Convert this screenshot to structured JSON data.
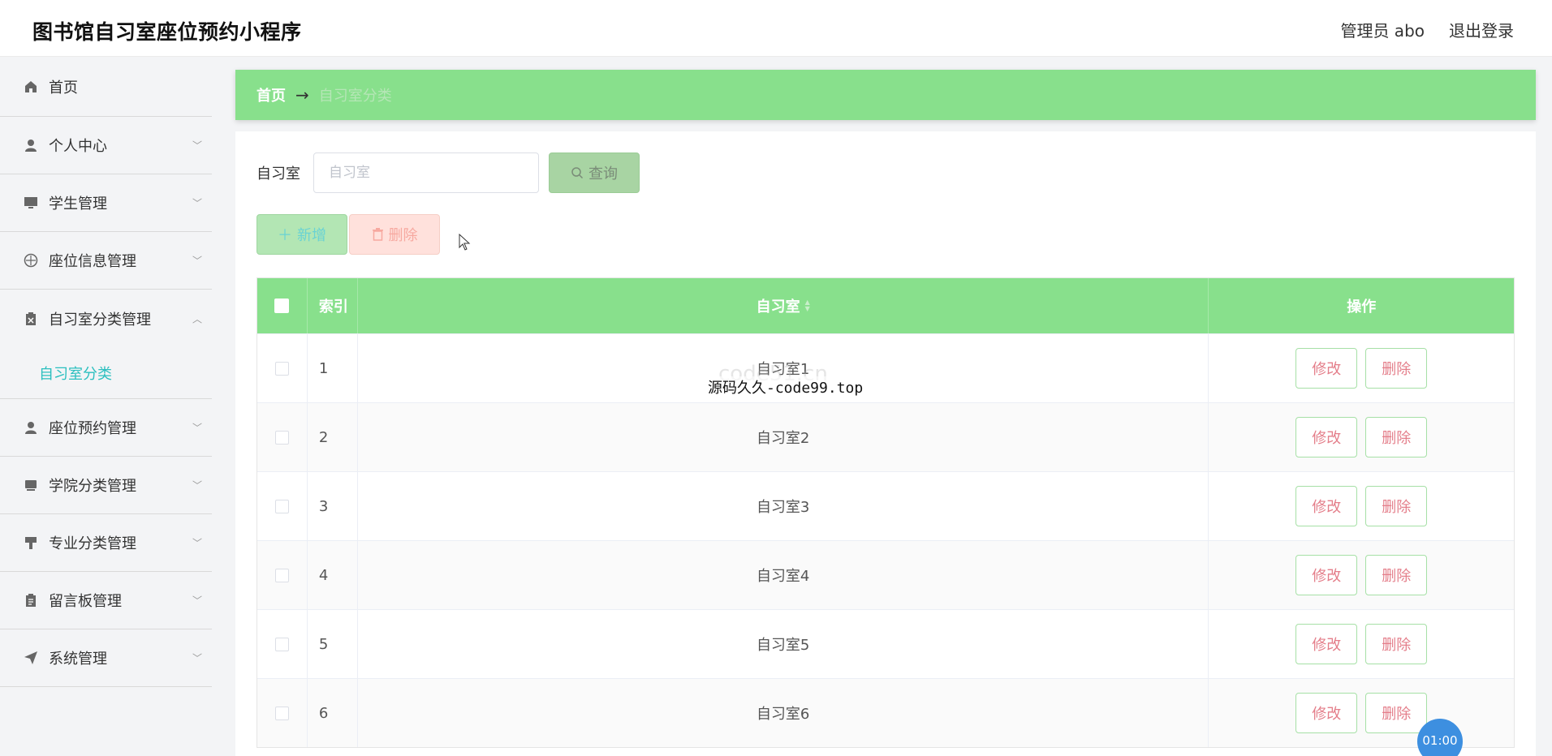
{
  "header": {
    "app_title": "图书馆自习室座位预约小程序",
    "admin_label": "管理员 abo",
    "logout_label": "退出登录"
  },
  "sidebar": {
    "items": [
      {
        "label": "首页",
        "icon": "home-icon"
      },
      {
        "label": "个人中心",
        "icon": "user-icon"
      },
      {
        "label": "学生管理",
        "icon": "monitor-icon"
      },
      {
        "label": "座位信息管理",
        "icon": "compass-icon"
      },
      {
        "label": "自习室分类管理",
        "icon": "clipboard-icon"
      },
      {
        "label": "座位预约管理",
        "icon": "user-icon"
      },
      {
        "label": "学院分类管理",
        "icon": "box-icon"
      },
      {
        "label": "专业分类管理",
        "icon": "brush-icon"
      },
      {
        "label": "留言板管理",
        "icon": "clipboard-icon"
      },
      {
        "label": "系统管理",
        "icon": "send-icon"
      }
    ],
    "active_sub": "自习室分类"
  },
  "breadcrumb": {
    "home": "首页",
    "separator": "→",
    "current": "自习室分类"
  },
  "search": {
    "label": "自习室",
    "placeholder": "自习室",
    "query_label": "查询"
  },
  "actions": {
    "add_label": "新增",
    "delete_label": "删除"
  },
  "table": {
    "headers": {
      "index": "索引",
      "name": "自习室",
      "ops": "操作"
    },
    "rows": [
      {
        "index": "1",
        "name": "自习室1"
      },
      {
        "index": "2",
        "name": "自习室2"
      },
      {
        "index": "3",
        "name": "自习室3"
      },
      {
        "index": "4",
        "name": "自习室4"
      },
      {
        "index": "5",
        "name": "自习室5"
      },
      {
        "index": "6",
        "name": "自习室6"
      }
    ],
    "edit_label": "修改",
    "delete_label": "删除"
  },
  "overlay": {
    "watermark": "源码久久-code99.top",
    "watermark_ghost": "code51.cn",
    "timer": "01:00"
  },
  "colors": {
    "accent_green": "#88e08c",
    "sub_active": "#2bbfbf",
    "danger_text": "#e47e8a"
  }
}
